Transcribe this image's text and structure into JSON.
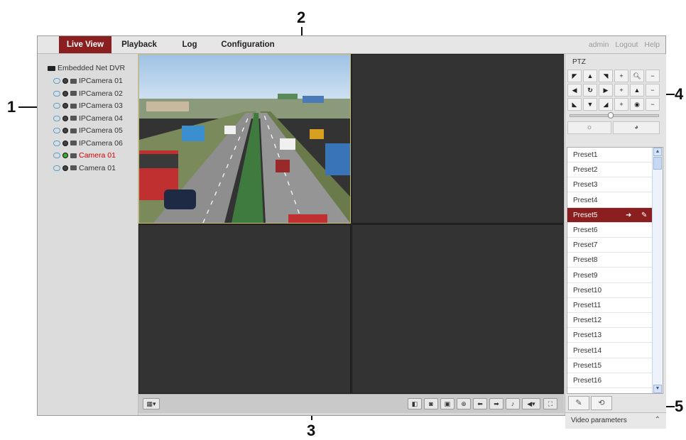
{
  "callouts": [
    "1",
    "2",
    "3",
    "4",
    "5"
  ],
  "nav": {
    "tabs": [
      "Live View",
      "Playback",
      "Log",
      "Configuration"
    ],
    "active_tab": "Live View",
    "user": "admin",
    "logout": "Logout",
    "help": "Help"
  },
  "tree": {
    "root": "Embedded Net DVR",
    "cameras": [
      "IPCamera 01",
      "IPCamera 02",
      "IPCamera 03",
      "IPCamera 04",
      "IPCamera 05",
      "IPCamera 06",
      "Camera 01",
      "Camera 01"
    ],
    "highlighted_index": 6
  },
  "ptz": {
    "title": "PTZ",
    "presets": [
      "Preset1",
      "Preset2",
      "Preset3",
      "Preset4",
      "Preset5",
      "Preset6",
      "Preset7",
      "Preset8",
      "Preset9",
      "Preset10",
      "Preset11",
      "Preset12",
      "Preset13",
      "Preset14",
      "Preset15",
      "Preset16"
    ],
    "selected_preset": "Preset5"
  },
  "video_parameters": {
    "label": "Video parameters"
  },
  "colors": {
    "accent": "#8b1e1e",
    "highlight_text": "#d40000",
    "pane_bg": "#333333"
  }
}
